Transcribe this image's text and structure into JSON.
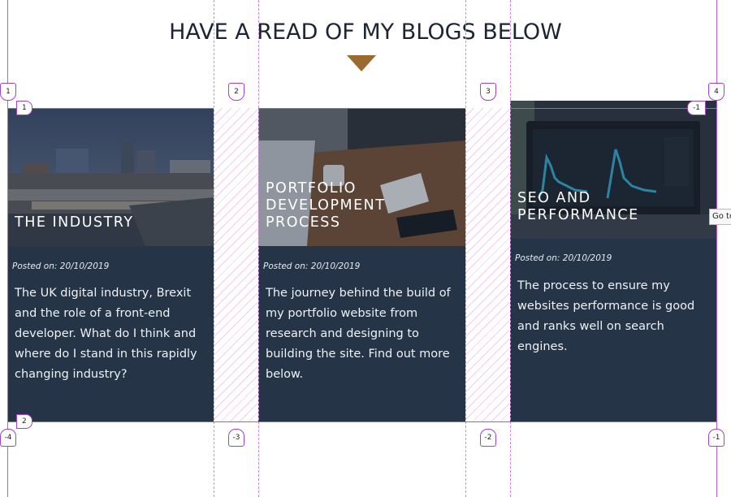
{
  "page": {
    "heading": "HAVE A READ OF MY BLOGS BELOW"
  },
  "cards": [
    {
      "title": "THE INDUSTRY",
      "posted": "Posted on: 20/10/2019",
      "excerpt": "The UK digital industry, Brexit and the role of a front-end developer. What do I think and where do I stand in this rapidly changing industry?",
      "image": "city-skyline-photo"
    },
    {
      "title": "PORTFOLIO DEVELOPMENT PROCESS",
      "posted": "Posted on: 20/10/2019",
      "excerpt": "The journey behind the build of my portfolio website from research and designing to building the site. Find out more below.",
      "image": "desk-workspace-photo"
    },
    {
      "title": "SEO AND PERFORMANCE",
      "posted": "Posted on: 20/10/2019",
      "excerpt": "The process to ensure my websites performance is good and ranks well on search engines.",
      "image": "analytics-laptop-photo"
    }
  ],
  "grid_overlay": {
    "column_lines_top": [
      "1",
      "2",
      "3",
      "4"
    ],
    "column_lines_bottom": [
      "-4",
      "-3",
      "-2",
      "-1"
    ],
    "row_tags": [
      "1",
      "2",
      "-1"
    ]
  },
  "tooltip": {
    "text": "Go to"
  },
  "colors": {
    "card_bg": "#253447",
    "heading": "#1c2533",
    "arrow": "#9c6a2e",
    "grid_overlay": "#b84de0"
  }
}
